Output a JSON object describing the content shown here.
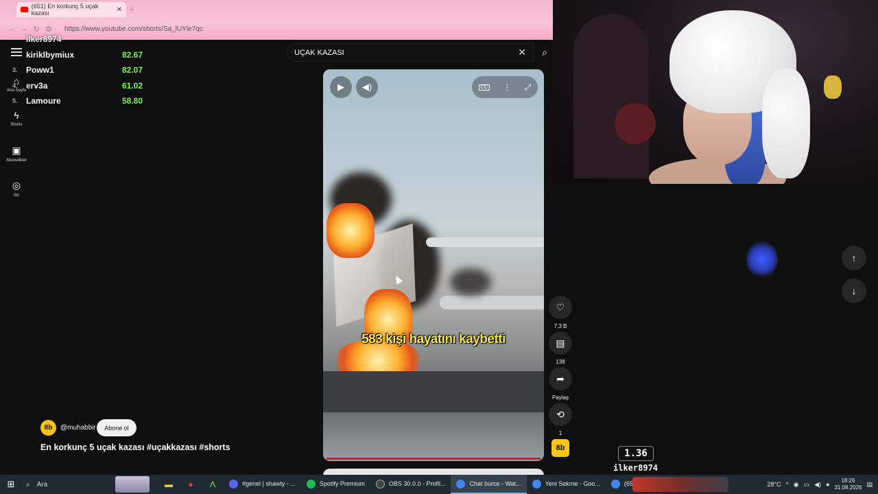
{
  "browser": {
    "tab_title": "(651) En korkunç 5 uçak kazası",
    "url": "https://www.youtube.com/shorts/Sa_lUYle7qc"
  },
  "sidebar": {
    "items": [
      {
        "label": "Ana Sayfa",
        "icon": "home-icon"
      },
      {
        "label": "Shorts",
        "icon": "shorts-icon"
      },
      {
        "label": "Abonelikler",
        "icon": "subscriptions-icon"
      },
      {
        "label": "Siz",
        "icon": "user-icon"
      }
    ]
  },
  "leaderboard": {
    "rows": [
      {
        "rank": "",
        "name": "ilker8974",
        "score": ""
      },
      {
        "rank": "",
        "name": "kiriklbymiux",
        "score": "82.67"
      },
      {
        "rank": "3.",
        "name": "Poww1",
        "score": "82.07"
      },
      {
        "rank": "4.",
        "name": "erv3a",
        "score": "61.02"
      },
      {
        "rank": "5.",
        "name": "Lamoure",
        "score": "58.80"
      }
    ]
  },
  "search": {
    "value": "UÇAK KAZASI"
  },
  "video": {
    "subtitle": "583 kişi hayatını kaybetti",
    "progress": 1.0
  },
  "actions": {
    "likes": "7,3 B",
    "comments": "138",
    "share": "Paylaş",
    "remix": "1"
  },
  "channel": {
    "handle": "@muhabbir",
    "avatar_text": "8b",
    "subscribe_label": "Abone ol",
    "video_title": "En korkunç 5 uçak kazası #uçakkazası #shorts"
  },
  "overlay": {
    "score": "1.36",
    "user": "ilker8974"
  },
  "taskbar": {
    "search_label": "Ara",
    "apps": [
      {
        "label": "#genel | shawty - ...",
        "color": "#5865f2",
        "active": false
      },
      {
        "label": "Spotify Premium",
        "color": "#1db954",
        "active": false
      },
      {
        "label": "OBS 30.0.0 - Profil...",
        "color": "#444444",
        "active": false
      },
      {
        "label": "Chat burce - Wat...",
        "color": "#4285f4",
        "active": true
      },
      {
        "label": "Yeni Sekme - Goo...",
        "color": "#4285f4",
        "active": false
      },
      {
        "label": "(651) En korkunç",
        "color": "#4285f4",
        "active": false
      }
    ],
    "temperature": "28°C",
    "time": "18:26",
    "date": "31.08.2026"
  },
  "colors": {
    "score_green": "#7cfc4f",
    "subtitle_yellow": "#f5e45a",
    "progress_red": "#e0132b",
    "browser_pink": "#f7c4d8"
  }
}
